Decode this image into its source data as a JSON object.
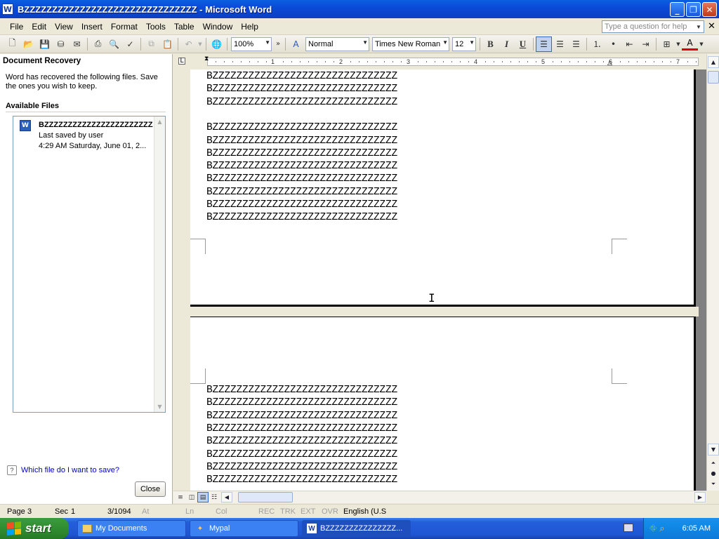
{
  "window": {
    "title": "BZZZZZZZZZZZZZZZZZZZZZZZZZZZZZZZ - Microsoft Word",
    "app_icon": "word-icon"
  },
  "menu": [
    "File",
    "Edit",
    "View",
    "Insert",
    "Format",
    "Tools",
    "Table",
    "Window",
    "Help"
  ],
  "help_box": {
    "placeholder": "Type a question for help"
  },
  "toolbar": {
    "zoom": "100%",
    "style": "Normal",
    "font": "Times New Roman",
    "size": "12",
    "bold": "B",
    "italic": "I",
    "underline": "U"
  },
  "ruler": {
    "numbers": [
      "1",
      "2",
      "3",
      "4",
      "5",
      "6",
      "7"
    ]
  },
  "task_pane": {
    "title": "Document Recovery",
    "message": "Word has recovered the following files.  Save the ones you wish to keep.",
    "available_files_label": "Available Files",
    "file": {
      "name": "BZZZZZZZZZZZZZZZZZZZZZZZZ...",
      "status": "Last saved by user",
      "time": "4:29 AM Saturday, June 01, 2..."
    },
    "help_link": "Which file do I want to save?",
    "close_label": "Close"
  },
  "document": {
    "page1_lines": [
      "BZZZZZZZZZZZZZZZZZZZZZZZZZZZZZZZ",
      "BZZZZZZZZZZZZZZZZZZZZZZZZZZZZZZZ",
      "BZZZZZZZZZZZZZZZZZZZZZZZZZZZZZZZ",
      "",
      "BZZZZZZZZZZZZZZZZZZZZZZZZZZZZZZZ",
      "BZZZZZZZZZZZZZZZZZZZZZZZZZZZZZZZ",
      "BZZZZZZZZZZZZZZZZZZZZZZZZZZZZZZZ",
      "BZZZZZZZZZZZZZZZZZZZZZZZZZZZZZZZ",
      "BZZZZZZZZZZZZZZZZZZZZZZZZZZZZZZZ",
      "BZZZZZZZZZZZZZZZZZZZZZZZZZZZZZZZ",
      "BZZZZZZZZZZZZZZZZZZZZZZZZZZZZZZZ",
      "BZZZZZZZZZZZZZZZZZZZZZZZZZZZZZZZ"
    ],
    "page2_lines": [
      "BZZZZZZZZZZZZZZZZZZZZZZZZZZZZZZZ",
      "BZZZZZZZZZZZZZZZZZZZZZZZZZZZZZZZ",
      "BZZZZZZZZZZZZZZZZZZZZZZZZZZZZZZZ",
      "BZZZZZZZZZZZZZZZZZZZZZZZZZZZZZZZ",
      "BZZZZZZZZZZZZZZZZZZZZZZZZZZZZZZZ",
      "BZZZZZZZZZZZZZZZZZZZZZZZZZZZZZZZ",
      "BZZZZZZZZZZZZZZZZZZZZZZZZZZZZZZZ",
      "BZZZZZZZZZZZZZZZZZZZZZZZZZZZZZZZ"
    ]
  },
  "status_bar": {
    "page": "Page",
    "page_num": "3",
    "sec": "Sec",
    "sec_num": "1",
    "pages": "3/1094",
    "at": "At",
    "ln": "Ln",
    "col": "Col",
    "rec": "REC",
    "trk": "TRK",
    "ext": "EXT",
    "ovr": "OVR",
    "language": "English (U.S"
  },
  "taskbar": {
    "start": "start",
    "items": [
      {
        "label": "My Documents",
        "icon": "folder-icon"
      },
      {
        "label": "Mypal",
        "icon": "browser-icon"
      },
      {
        "label": "BZZZZZZZZZZZZZZZ...",
        "icon": "word-icon"
      }
    ],
    "clock": "6:05 AM"
  },
  "colors": {
    "title_bar": "#0a4ad8",
    "taskbar": "#245edb",
    "start_button": "#2f8a2f",
    "link": "#0000c8"
  }
}
